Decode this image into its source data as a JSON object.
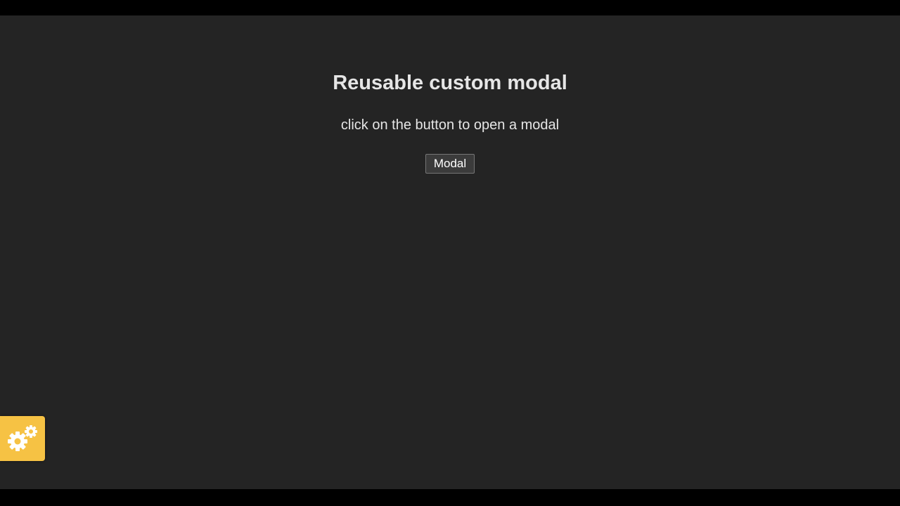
{
  "page": {
    "title": "Reusable custom modal",
    "subtitle": "click on the button to open a modal"
  },
  "modal_button": {
    "label": "Modal"
  },
  "settings_widget": {
    "icon": "gears-icon",
    "color": "#f6c244"
  },
  "colors": {
    "background": "#242424",
    "text": "#e6e6e6"
  }
}
